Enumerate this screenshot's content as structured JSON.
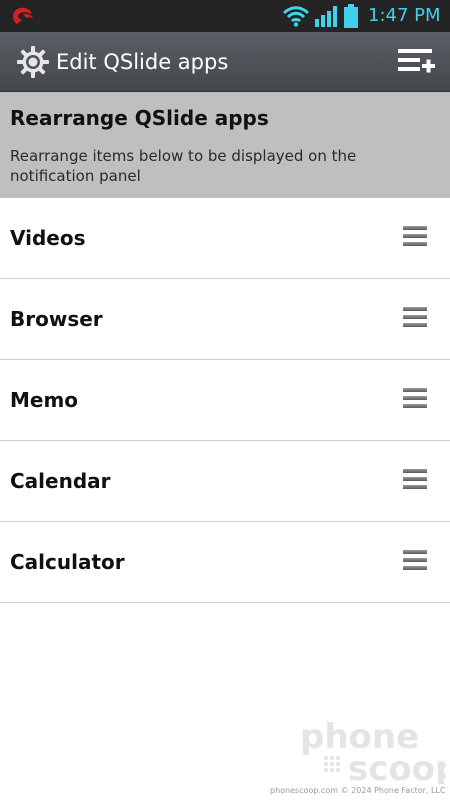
{
  "status_bar": {
    "time": "1:47 PM",
    "icons": [
      "carrier-icon",
      "wifi-icon",
      "signal-icon",
      "battery-icon"
    ],
    "clock_color": "#3fd2ea",
    "carrier_color": "#d42020"
  },
  "action_bar": {
    "title": "Edit QSlide apps",
    "icons": [
      "settings-icon",
      "add-list-icon"
    ]
  },
  "header": {
    "title": "Rearrange QSlide apps",
    "description": "Rearrange items below to be displayed on the notification panel"
  },
  "apps": [
    {
      "label": "Videos"
    },
    {
      "label": "Browser"
    },
    {
      "label": "Memo"
    },
    {
      "label": "Calendar"
    },
    {
      "label": "Calculator"
    }
  ],
  "watermark": {
    "brand": "phonescoop",
    "footer": "phonescoop.com  © 2024 Phone Factor, LLC"
  }
}
